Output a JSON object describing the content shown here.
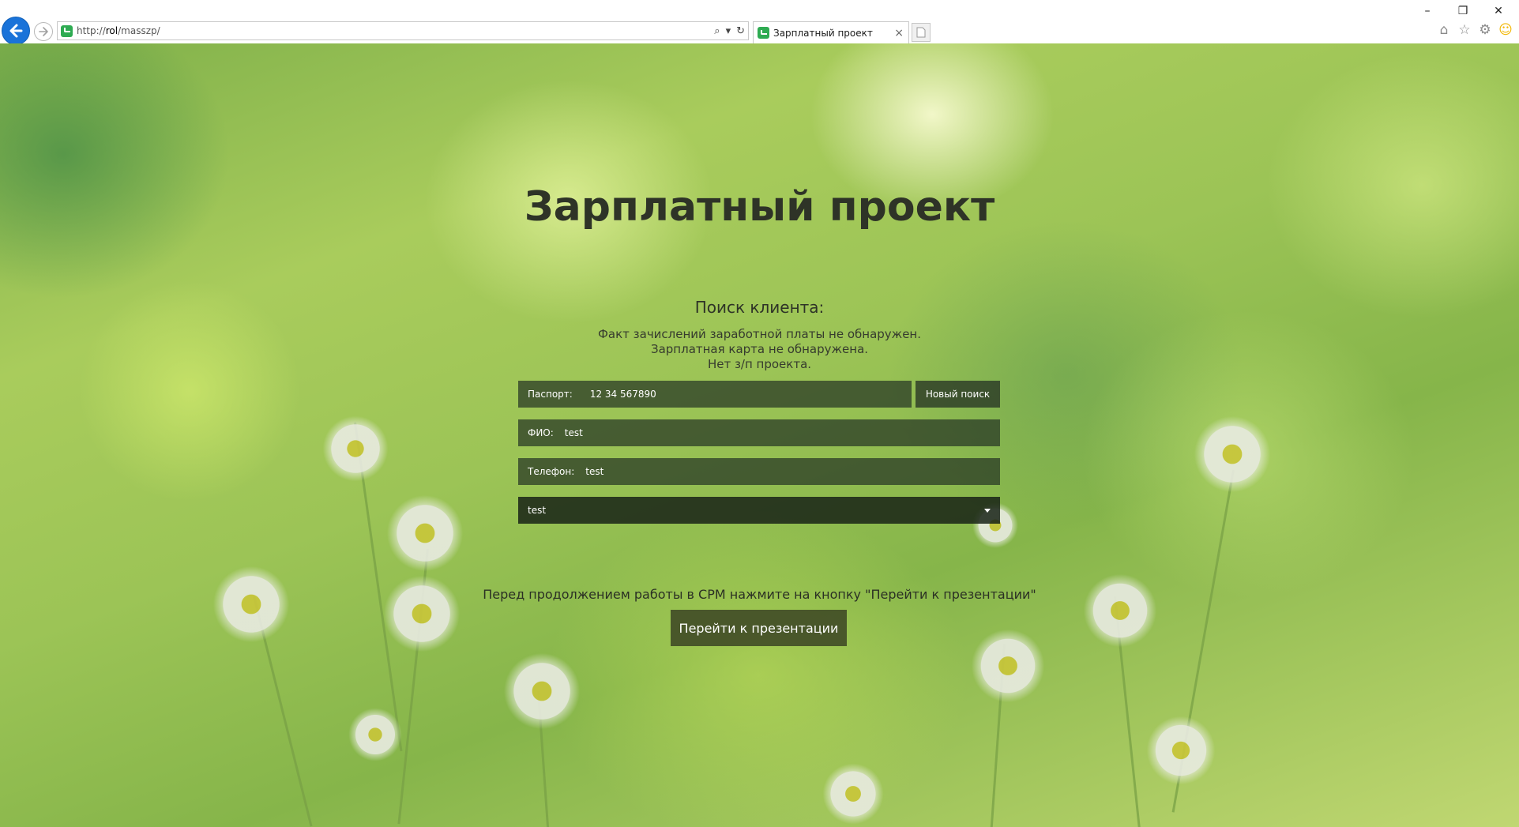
{
  "browser": {
    "url_prefix": "http://",
    "url_host": "rol",
    "url_path": "/masszp/",
    "search_icon": "⌕",
    "dropdown_icon": "▾",
    "refresh_icon": "↻",
    "tab_title": "Зарплатный проект",
    "tab_close": "×",
    "window_controls": {
      "minimize": "–",
      "restore": "❐",
      "close": "✕"
    },
    "toolbar_icons": {
      "home": "⌂",
      "favorites": "☆",
      "settings": "⚙",
      "feedback": "☺"
    },
    "colors": {
      "back_button": "#1a73d9",
      "site_icon": "#2eab52"
    }
  },
  "page": {
    "title": "Зарплатный проект",
    "subtitle": "Поиск клиента:",
    "status_lines": [
      "Факт зачислений заработной платы не обнаружен.",
      "Зарплатная карта не обнаружена.",
      "Нет з/п проекта."
    ],
    "form": {
      "passport_label": "Паспорт:",
      "passport_value": "12 34 567890",
      "new_search_label": "Новый поиск",
      "fio_label": "ФИО:",
      "fio_value": "test",
      "phone_label": "Телефон:",
      "phone_value": "test",
      "select_value": "test"
    },
    "notice": "Перед продолжением работы в СРМ нажмите на кнопку \"Перейти к презентации\"",
    "presentation_button": "Перейти к презентации"
  }
}
